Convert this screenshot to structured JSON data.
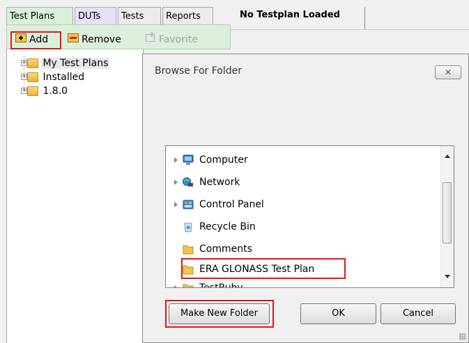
{
  "tabs": [
    {
      "label": "Test Plans",
      "active": true
    },
    {
      "label": "DUTs",
      "active": false
    },
    {
      "label": "Tests",
      "active": false
    },
    {
      "label": "Reports",
      "active": false
    }
  ],
  "right_tab": {
    "label": "No Testplan Loaded"
  },
  "toolbar": {
    "add_label": "Add",
    "remove_label": "Remove",
    "favorite_label": "Favorite"
  },
  "tree": {
    "items": [
      {
        "label": "My Test Plans",
        "selected": true
      },
      {
        "label": "Installed",
        "selected": false
      },
      {
        "label": "1.8.0",
        "selected": false
      }
    ]
  },
  "dialog": {
    "title": "Browse For Folder",
    "close_glyph": "✕",
    "folders": [
      {
        "label": "Computer",
        "icon": "computer-icon",
        "expandable": true
      },
      {
        "label": "Network",
        "icon": "network-icon",
        "expandable": true
      },
      {
        "label": "Control Panel",
        "icon": "control-panel-icon",
        "expandable": true
      },
      {
        "label": "Recycle Bin",
        "icon": "recycle-bin-icon",
        "expandable": false
      },
      {
        "label": "Comments",
        "icon": "folder-icon",
        "expandable": false
      },
      {
        "label": "ERA GLONASS Test Plan",
        "icon": "folder-icon",
        "expandable": false
      },
      {
        "label": "TestRuby",
        "icon": "folder-icon",
        "expandable": true
      }
    ],
    "buttons": {
      "make_new_folder": "Make New Folder",
      "ok": "OK",
      "cancel": "Cancel"
    }
  },
  "colors": {
    "highlight": "#e01515",
    "active_tab": "#d9efd9",
    "dut_tab": "#e6e2f6"
  }
}
